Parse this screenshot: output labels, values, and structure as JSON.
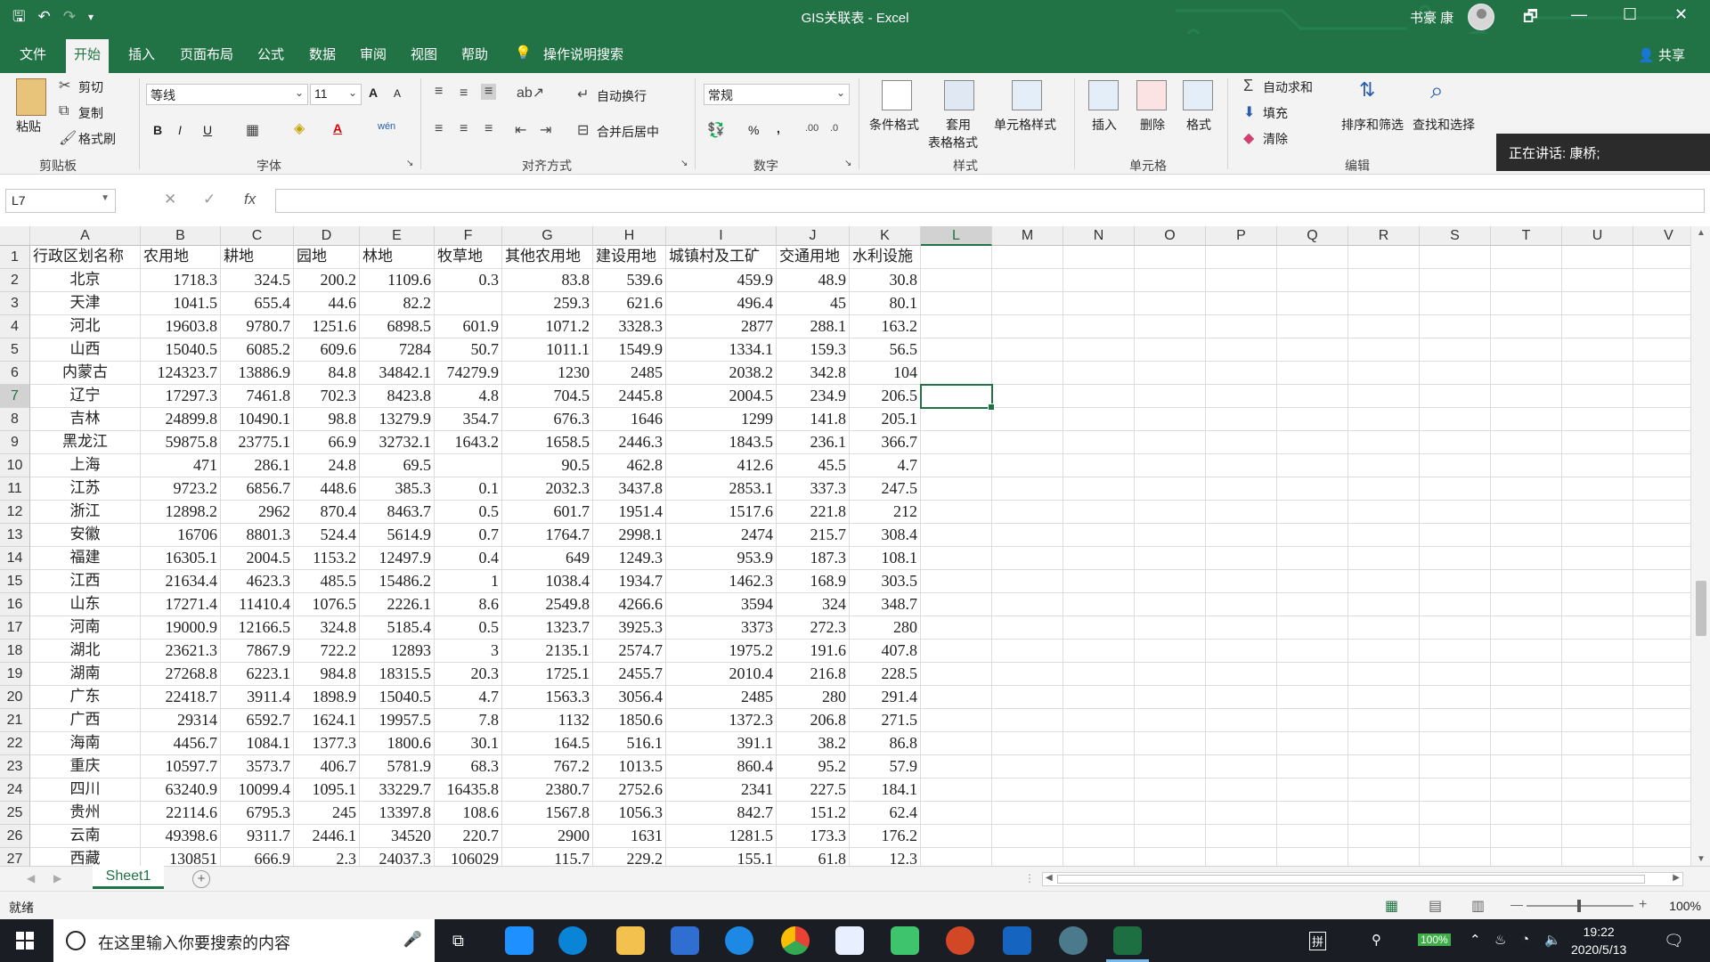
{
  "window": {
    "title": "GIS关联表  -  Excel",
    "user": "书豪 康",
    "qat_save": "🖫",
    "qat_undo": "↶",
    "qat_redo": "↷",
    "qat_more": "▾",
    "btn_restore": "🗗",
    "btn_min": "—",
    "btn_max": "☐",
    "btn_close": "✕"
  },
  "tabs": [
    "文件",
    "开始",
    "插入",
    "页面布局",
    "公式",
    "数据",
    "审阅",
    "视图",
    "帮助"
  ],
  "tell_me": "操作说明搜索",
  "share": "共享",
  "ribbon": {
    "clipboard": {
      "paste": "粘贴",
      "cut": "剪切",
      "copy": "复制",
      "format_painter": "格式刷",
      "group": "剪贴板"
    },
    "font": {
      "name": "等线",
      "size": "11",
      "bold": "B",
      "italic": "I",
      "underline": "U",
      "grow": "A",
      "shrink": "A",
      "phonetic": "wén",
      "group": "字体"
    },
    "alignment": {
      "wrap": "自动换行",
      "merge": "合并后居中",
      "group": "对齐方式"
    },
    "number": {
      "format": "常规",
      "percent": "%",
      "comma": ",",
      "group": "数字"
    },
    "styles": {
      "cond": "条件格式",
      "table1": "套用",
      "table2": "表格格式",
      "cell": "单元格样式",
      "group": "样式"
    },
    "cells": {
      "insert": "插入",
      "delete": "删除",
      "format": "格式",
      "group": "单元格"
    },
    "editing": {
      "autosum": "自动求和",
      "fill": "填充",
      "clear": "清除",
      "sort": "排序和筛选",
      "find": "查找和选择",
      "group": "编辑"
    },
    "notification": "正在讲话: 康桥;"
  },
  "formula_bar": {
    "name_box": "L7",
    "fx": "fx",
    "cancel": "✕",
    "enter": "✓",
    "value": ""
  },
  "grid": {
    "columns": [
      "A",
      "B",
      "C",
      "D",
      "E",
      "F",
      "G",
      "H",
      "I",
      "J",
      "K",
      "L",
      "M",
      "N",
      "O",
      "P",
      "Q",
      "R",
      "S",
      "T",
      "U",
      "V"
    ],
    "selected_column": "L",
    "selected_row": "7",
    "headers": [
      "行政区划名称",
      "农用地",
      "耕地",
      "园地",
      "林地",
      "牧草地",
      "其他农用地",
      "建设用地",
      "城镇村及工矿",
      "交通用地",
      "水利设施"
    ],
    "rows": [
      [
        "北京",
        "1718.3",
        "324.5",
        "200.2",
        "1109.6",
        "0.3",
        "83.8",
        "539.6",
        "459.9",
        "48.9",
        "30.8"
      ],
      [
        "天津",
        "1041.5",
        "655.4",
        "44.6",
        "82.2",
        "",
        "259.3",
        "621.6",
        "496.4",
        "45",
        "80.1"
      ],
      [
        "河北",
        "19603.8",
        "9780.7",
        "1251.6",
        "6898.5",
        "601.9",
        "1071.2",
        "3328.3",
        "2877",
        "288.1",
        "163.2"
      ],
      [
        "山西",
        "15040.5",
        "6085.2",
        "609.6",
        "7284",
        "50.7",
        "1011.1",
        "1549.9",
        "1334.1",
        "159.3",
        "56.5"
      ],
      [
        "内蒙古",
        "124323.7",
        "13886.9",
        "84.8",
        "34842.1",
        "74279.9",
        "1230",
        "2485",
        "2038.2",
        "342.8",
        "104"
      ],
      [
        "辽宁",
        "17297.3",
        "7461.8",
        "702.3",
        "8423.8",
        "4.8",
        "704.5",
        "2445.8",
        "2004.5",
        "234.9",
        "206.5"
      ],
      [
        "吉林",
        "24899.8",
        "10490.1",
        "98.8",
        "13279.9",
        "354.7",
        "676.3",
        "1646",
        "1299",
        "141.8",
        "205.1"
      ],
      [
        "黑龙江",
        "59875.8",
        "23775.1",
        "66.9",
        "32732.1",
        "1643.2",
        "1658.5",
        "2446.3",
        "1843.5",
        "236.1",
        "366.7"
      ],
      [
        "上海",
        "471",
        "286.1",
        "24.8",
        "69.5",
        "",
        "90.5",
        "462.8",
        "412.6",
        "45.5",
        "4.7"
      ],
      [
        "江苏",
        "9723.2",
        "6856.7",
        "448.6",
        "385.3",
        "0.1",
        "2032.3",
        "3437.8",
        "2853.1",
        "337.3",
        "247.5"
      ],
      [
        "浙江",
        "12898.2",
        "2962",
        "870.4",
        "8463.7",
        "0.5",
        "601.7",
        "1951.4",
        "1517.6",
        "221.8",
        "212"
      ],
      [
        "安徽",
        "16706",
        "8801.3",
        "524.4",
        "5614.9",
        "0.7",
        "1764.7",
        "2998.1",
        "2474",
        "215.7",
        "308.4"
      ],
      [
        "福建",
        "16305.1",
        "2004.5",
        "1153.2",
        "12497.9",
        "0.4",
        "649",
        "1249.3",
        "953.9",
        "187.3",
        "108.1"
      ],
      [
        "江西",
        "21634.4",
        "4623.3",
        "485.5",
        "15486.2",
        "1",
        "1038.4",
        "1934.7",
        "1462.3",
        "168.9",
        "303.5"
      ],
      [
        "山东",
        "17271.4",
        "11410.4",
        "1076.5",
        "2226.1",
        "8.6",
        "2549.8",
        "4266.6",
        "3594",
        "324",
        "348.7"
      ],
      [
        "河南",
        "19000.9",
        "12166.5",
        "324.8",
        "5185.4",
        "0.5",
        "1323.7",
        "3925.3",
        "3373",
        "272.3",
        "280"
      ],
      [
        "湖北",
        "23621.3",
        "7867.9",
        "722.2",
        "12893",
        "3",
        "2135.1",
        "2574.7",
        "1975.2",
        "191.6",
        "407.8"
      ],
      [
        "湖南",
        "27268.8",
        "6223.1",
        "984.8",
        "18315.5",
        "20.3",
        "1725.1",
        "2455.7",
        "2010.4",
        "216.8",
        "228.5"
      ],
      [
        "广东",
        "22418.7",
        "3911.4",
        "1898.9",
        "15040.5",
        "4.7",
        "1563.3",
        "3056.4",
        "2485",
        "280",
        "291.4"
      ],
      [
        "广西",
        "29314",
        "6592.7",
        "1624.1",
        "19957.5",
        "7.8",
        "1132",
        "1850.6",
        "1372.3",
        "206.8",
        "271.5"
      ],
      [
        "海南",
        "4456.7",
        "1084.1",
        "1377.3",
        "1800.6",
        "30.1",
        "164.5",
        "516.1",
        "391.1",
        "38.2",
        "86.8"
      ],
      [
        "重庆",
        "10597.7",
        "3573.7",
        "406.7",
        "5781.9",
        "68.3",
        "767.2",
        "1013.5",
        "860.4",
        "95.2",
        "57.9"
      ],
      [
        "四川",
        "63240.9",
        "10099.4",
        "1095.1",
        "33229.7",
        "16435.8",
        "2380.7",
        "2752.6",
        "2341",
        "227.5",
        "184.1"
      ],
      [
        "贵州",
        "22114.6",
        "6795.3",
        "245",
        "13397.8",
        "108.6",
        "1567.8",
        "1056.3",
        "842.7",
        "151.2",
        "62.4"
      ],
      [
        "云南",
        "49398.6",
        "9311.7",
        "2446.1",
        "34520",
        "220.7",
        "2900",
        "1631",
        "1281.5",
        "173.3",
        "176.2"
      ],
      [
        "西藏",
        "130851",
        "666.9",
        "2.3",
        "24037.3",
        "106029",
        "115.7",
        "229.2",
        "155.1",
        "61.8",
        "12.3"
      ]
    ]
  },
  "sheet_tab": "Sheet1",
  "add_sheet": "+",
  "status": {
    "ready": "就绪",
    "zoom": "100%",
    "zoom_minus": "—",
    "zoom_plus": "+"
  },
  "taskbar": {
    "search_placeholder": "在这里输入你要搜索的内容",
    "time": "19:22",
    "date": "2020/5/13",
    "battery": "100%",
    "ime": "拼",
    "mic": "🎤"
  },
  "colors": {
    "excel_green": "#217346",
    "ribbon_bg": "#f3f3f3",
    "taskbar": "#1a1e24"
  }
}
